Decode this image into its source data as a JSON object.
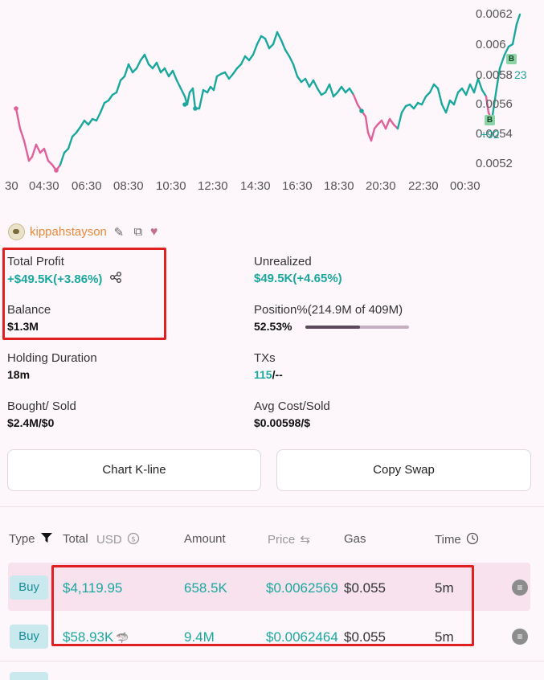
{
  "chart": {
    "y_ticks": [
      "0.0062",
      "0.006",
      "0.0058",
      "0.0056",
      "0.0054",
      "0.0052"
    ],
    "x_ticks": [
      "30",
      "04:30",
      "06:30",
      "08:30",
      "10:30",
      "12:30",
      "14:30",
      "16:30",
      "18:30",
      "20:30",
      "22:30",
      "00:30"
    ],
    "markers": [
      {
        "label": "B",
        "value": "23"
      },
      {
        "label": "B",
        "value": "+92"
      }
    ],
    "up_color": "#1aa89e",
    "down_color": "#e0609a"
  },
  "user": {
    "name": "kippahstayson",
    "icons": [
      "avatar",
      "edit-icon",
      "copy-icon",
      "heart-icon"
    ]
  },
  "stats": {
    "total_profit": {
      "label": "Total Profit",
      "value": "+$49.5K(+3.86%)"
    },
    "unrealized": {
      "label": "Unrealized",
      "value": "$49.5K(+4.65%)"
    },
    "balance": {
      "label": "Balance",
      "value": "$1.3M"
    },
    "position": {
      "label": "Position%(214.9M of 409M)",
      "value": "52.53%",
      "fraction": 0.5253
    },
    "holding_duration": {
      "label": "Holding Duration",
      "value": "18m"
    },
    "txs": {
      "label": "TXs",
      "buys": "115",
      "rest": "/--"
    },
    "bought_sold": {
      "label": "Bought/ Sold",
      "value": "$2.4M/$0"
    },
    "avg_cost": {
      "label": "Avg Cost/Sold",
      "value": "$0.00598/$"
    }
  },
  "buttons": {
    "chart_kline": "Chart K-line",
    "copy_swap": "Copy Swap"
  },
  "table": {
    "headers": {
      "type": "Type",
      "total": "Total",
      "usd": "USD",
      "amount": "Amount",
      "price": "Price",
      "gas": "Gas",
      "time": "Time"
    },
    "rows": [
      {
        "type": "Buy",
        "total": "$4,119.95",
        "amount": "658.5K",
        "price": "$0.0062569",
        "gas": "$0.055",
        "time": "5m"
      },
      {
        "type": "Buy",
        "total": "$58.93K",
        "amount": "9.4M",
        "price": "$0.0062464",
        "gas": "$0.055",
        "time": "5m"
      }
    ]
  }
}
